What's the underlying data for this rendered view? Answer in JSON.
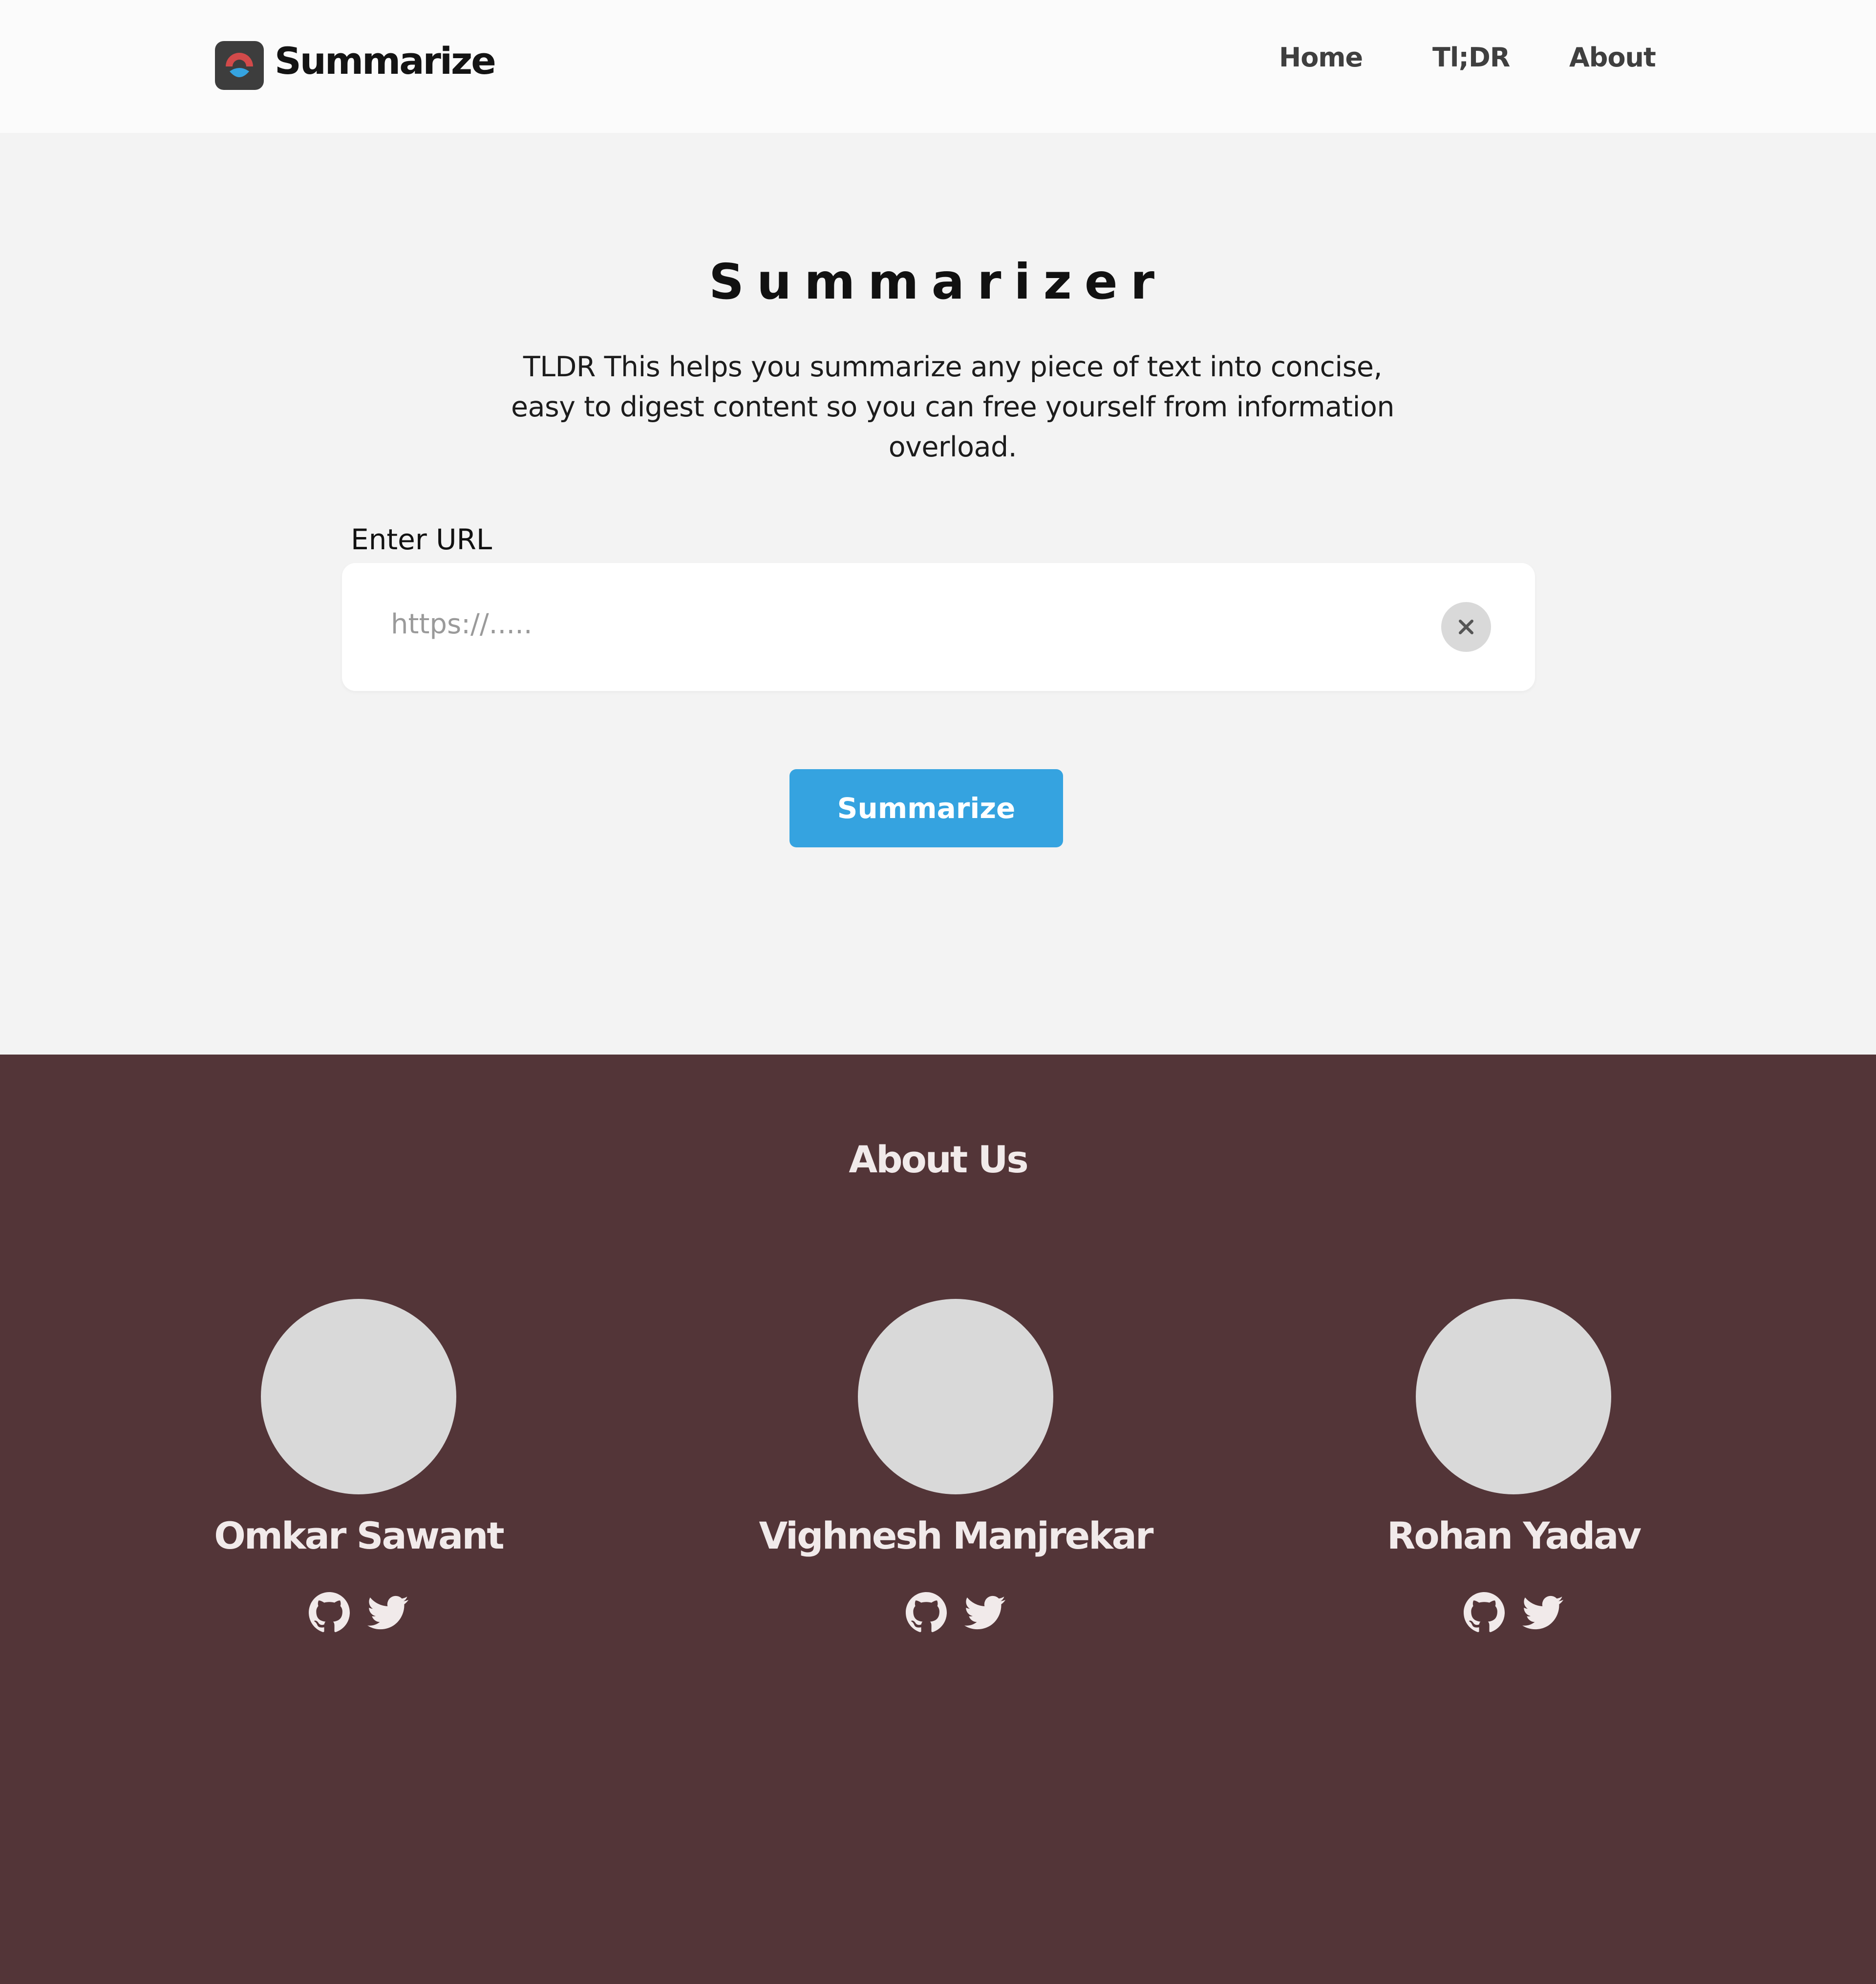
{
  "header": {
    "brand": "Summarize",
    "logo_icon": "summarize-logo-icon",
    "nav": [
      {
        "label": "Home"
      },
      {
        "label": "Tl;DR"
      },
      {
        "label": "About"
      }
    ]
  },
  "hero": {
    "title": "Summarizer",
    "description": "TLDR This helps you summarize any piece of text into concise, easy to digest content so you can free yourself from information overload.",
    "url_label": "Enter URL",
    "url_placeholder": "https://.....",
    "url_value": "",
    "clear_icon": "close-icon",
    "button_label": "Summarize"
  },
  "about": {
    "title": "About Us",
    "members": [
      {
        "name": "Omkar Sawant",
        "icons": [
          "github-icon",
          "twitter-icon"
        ]
      },
      {
        "name": "Vighnesh Manjrekar",
        "icons": [
          "github-icon",
          "twitter-icon"
        ]
      },
      {
        "name": "Rohan Yadav",
        "icons": [
          "github-icon",
          "twitter-icon"
        ]
      }
    ]
  },
  "colors": {
    "header_bg": "#fbfbfb",
    "page_bg": "#f3f3f3",
    "accent": "#35a3e0",
    "about_bg": "#533538",
    "about_text": "#f1eaea",
    "avatar": "#d9d9d9"
  }
}
